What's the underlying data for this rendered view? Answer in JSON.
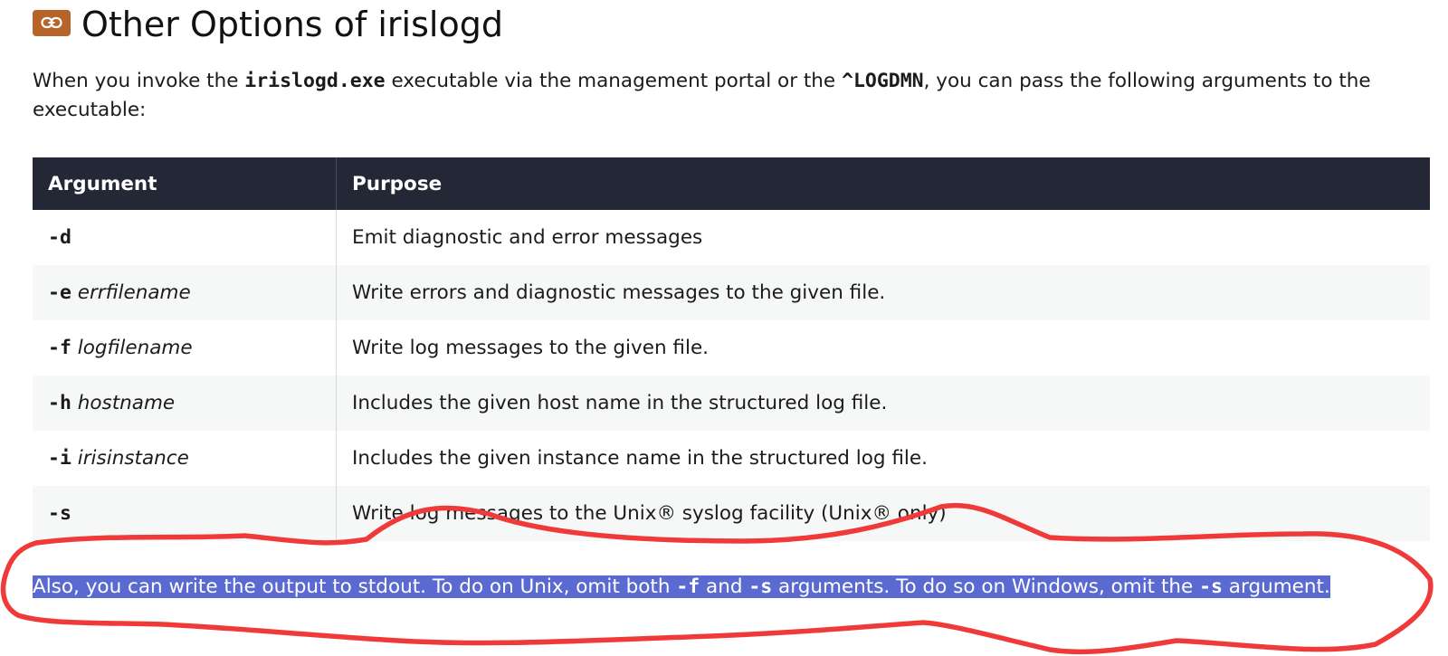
{
  "heading": {
    "icon": "link-icon",
    "icon_color": "#b5642a",
    "title": "Other Options of irislogd"
  },
  "intro": {
    "part1": "When you invoke the ",
    "code1": "irislogd.exe",
    "part2": " executable via the management portal or the ",
    "code2": "^LOGDMN",
    "part3": ", you can pass the following arguments to the executable:"
  },
  "table": {
    "headers": [
      "Argument",
      "Purpose"
    ],
    "header_bg": "#242736",
    "rows": [
      {
        "flag": "-d",
        "param": "",
        "purpose": "Emit diagnostic and error messages"
      },
      {
        "flag": "-e",
        "param": "errfilename",
        "purpose": "Write errors and diagnostic messages to the given file."
      },
      {
        "flag": "-f",
        "param": "logfilename",
        "purpose": "Write log messages to the given file."
      },
      {
        "flag": "-h",
        "param": "hostname",
        "purpose": "Includes the given host name in the structured log file."
      },
      {
        "flag": "-i",
        "param": "irisinstance",
        "purpose": "Includes the given instance name in the structured log file."
      },
      {
        "flag": "-s",
        "param": "",
        "purpose": "Write log messages to the Unix® syslog facility (Unix® only)"
      }
    ]
  },
  "note": {
    "part1": "Also, you can write the output to stdout. To do on Unix, omit both ",
    "code1": "-f",
    "part2": " and ",
    "code2": "-s",
    "part3": " arguments. To do so on Windows, omit the ",
    "code3": "-s",
    "part4": " argument.",
    "selection_color": "#5b6ad0"
  },
  "annotation": {
    "color": "#f03a3a"
  }
}
